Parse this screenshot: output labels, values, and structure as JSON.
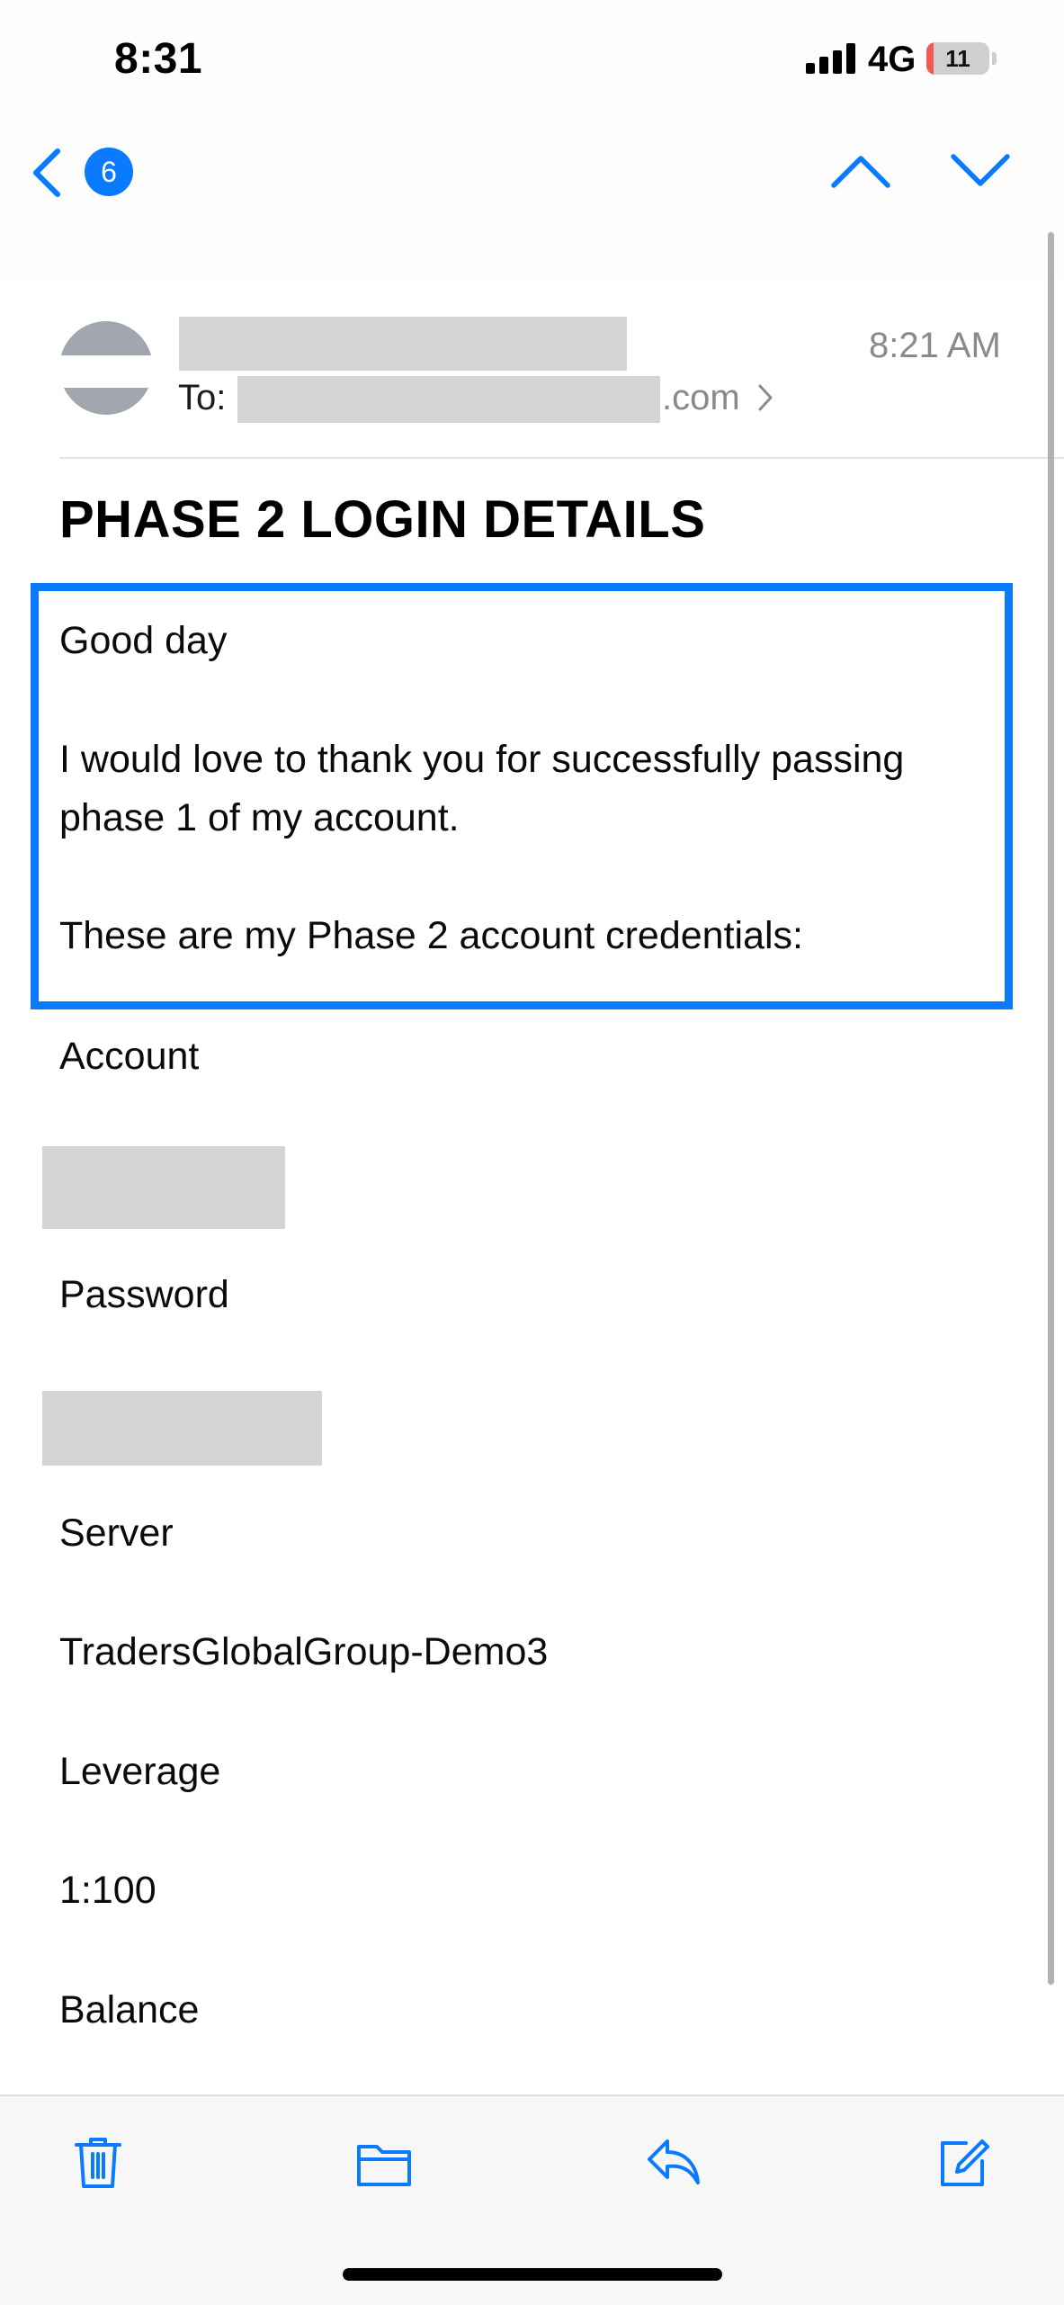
{
  "status_bar": {
    "time": "8:31",
    "network": "4G",
    "battery": "11",
    "battery_level": 0.11
  },
  "nav": {
    "unread_count": "6"
  },
  "email": {
    "time": "8:21 AM",
    "to_label": "To:",
    "to_suffix": ".com",
    "subject": "PHASE 2 LOGIN DETAILS",
    "body": {
      "greeting": "Good day",
      "thanks_line1": "I would love to thank you for successfully passing",
      "thanks_line2": "phase 1 of my account.",
      "credentials_intro": "These are my Phase 2 account credentials:",
      "account_label": "Account",
      "password_label": "Password",
      "server_label": "Server",
      "server_value": "TradersGlobalGroup-Demo3",
      "leverage_label": "Leverage",
      "leverage_value": "1:100",
      "balance_label": "Balance"
    }
  },
  "icons": {
    "back": "chevron-left-icon",
    "up": "chevron-up-icon",
    "down": "chevron-down-icon",
    "trash": "trash-icon",
    "folder": "folder-icon",
    "reply": "reply-icon",
    "compose": "compose-icon"
  },
  "colors": {
    "accent": "#0a7aff",
    "redaction": "#d4d4d4",
    "secondary_text": "#8a8a8e"
  }
}
